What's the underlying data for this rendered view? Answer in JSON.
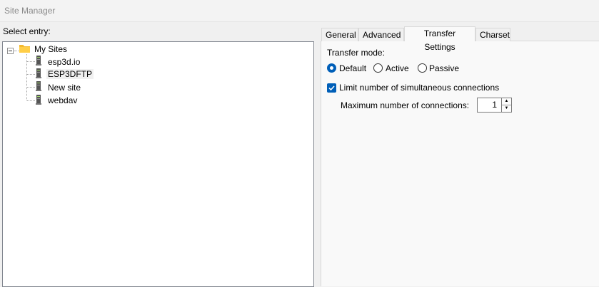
{
  "window": {
    "title": "Site Manager"
  },
  "tree": {
    "label": "Select entry:",
    "root": {
      "label": "My Sites",
      "icon": "folder-icon"
    },
    "items": [
      {
        "label": "esp3d.io",
        "icon": "site-icon"
      },
      {
        "label": "ESP3DFTP",
        "icon": "site-icon",
        "selected": true
      },
      {
        "label": "New site",
        "icon": "site-icon"
      },
      {
        "label": "webdav",
        "icon": "site-icon"
      }
    ]
  },
  "tabs": [
    {
      "label": "General"
    },
    {
      "label": "Advanced"
    },
    {
      "label": "Transfer Settings",
      "active": true
    },
    {
      "label": "Charset"
    }
  ],
  "transfer": {
    "mode_label": "Transfer mode:",
    "modes": [
      {
        "label": "Default",
        "checked": true
      },
      {
        "label": "Active",
        "checked": false
      },
      {
        "label": "Passive",
        "checked": false
      }
    ],
    "limit_label": "Limit number of simultaneous connections",
    "limit_checked": true,
    "max_label": "Maximum number of connections:",
    "max_value": "1"
  },
  "colors": {
    "accent": "#005fb8",
    "tree_border": "#828790"
  }
}
